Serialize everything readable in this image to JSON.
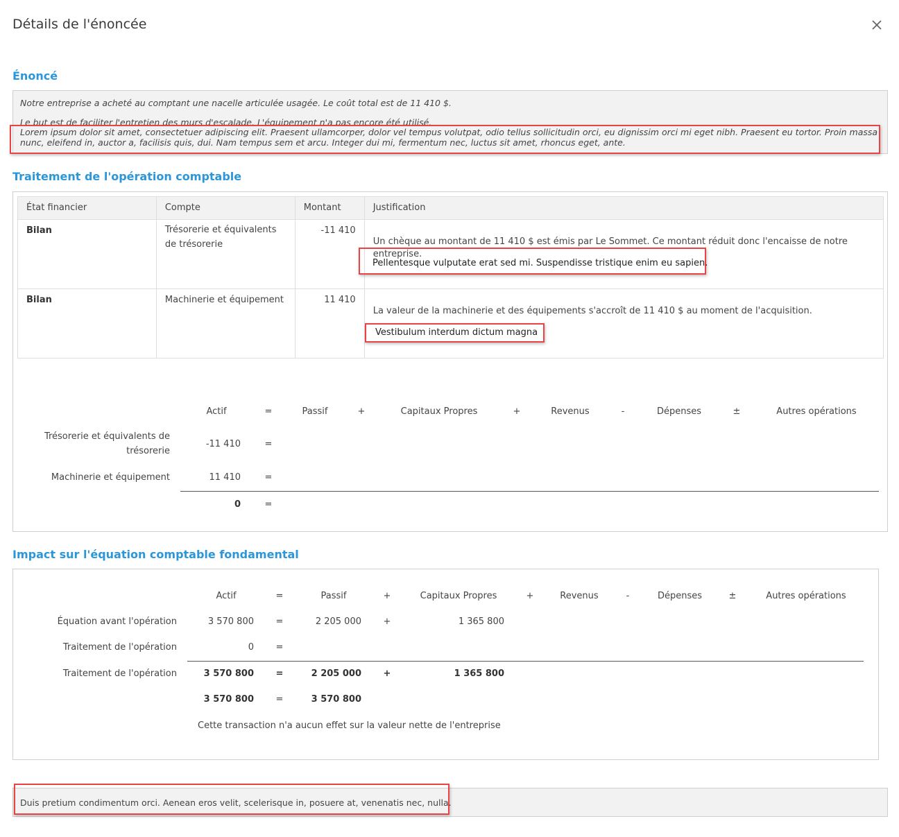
{
  "modal": {
    "title": "Détails de l'énoncée",
    "close_label": "×"
  },
  "enonce": {
    "title": "Énoncé",
    "line1": "Notre entreprise a acheté au comptant une nacelle articulée usagée. Le coût total est de 11 410 $.",
    "line2": "Le but est de faciliter l'entretien des murs d'escalade. L'équipement n'a pas encore été utilisé.",
    "lorem": "Lorem ipsum dolor sit amet, consectetuer adipiscing elit. Praesent ullamcorper, dolor vel tempus volutpat, odio tellus sollicitudin orci, eu dignissim orci mi eget nibh. Praesent eu tortor. Proin massa nunc, eleifend in, auctor a, facilisis quis, dui. Nam tempus sem et arcu. Integer dui mi, fermentum nec, luctus sit amet, rhoncus eget, ante."
  },
  "traitement": {
    "title": "Traitement de l'opération comptable",
    "headers": [
      "État financier",
      "Compte",
      "Montant",
      "Justification"
    ],
    "rows": [
      {
        "etat": "Bilan",
        "compte": "Trésorerie et équivalents de trésorerie",
        "montant": "-11 410",
        "justification": "Un chèque au montant de 11 410 $ est émis par Le Sommet. Ce montant réduit donc l'encaisse de notre entreprise.",
        "note": "Pellentesque vulputate erat sed mi. Suspendisse tristique enim eu sapien."
      },
      {
        "etat": "Bilan",
        "compte": "Machinerie et équipement",
        "montant": "11 410",
        "justification": "La valeur de la machinerie et des équipements s'accroît de 11 410 $ au moment de l'acquisition.",
        "note": "Vestibulum interdum dictum magna"
      }
    ],
    "equation": {
      "headers": {
        "actif": "Actif",
        "eq": "=",
        "passif": "Passif",
        "plus1": "+",
        "capitaux": "Capitaux Propres",
        "plus2": "+",
        "revenus": "Revenus",
        "minus": "-",
        "depenses": "Dépenses",
        "pm": "±",
        "autres": "Autres opérations"
      },
      "rows": [
        {
          "label_line1": "Trésorerie et équivalents de",
          "label_line2": "trésorerie",
          "actif": "-11 410",
          "eq": "="
        },
        {
          "label": "Machinerie et équipement",
          "actif": "11 410",
          "eq": "="
        }
      ],
      "total": {
        "actif": "0",
        "eq": "="
      }
    }
  },
  "impact": {
    "title": "Impact sur l'équation comptable fondamental",
    "headers": {
      "actif": "Actif",
      "eq": "=",
      "passif": "Passif",
      "plus1": "+",
      "capitaux": "Capitaux Propres",
      "plus2": "+",
      "revenus": "Revenus",
      "minus": "-",
      "depenses": "Dépenses",
      "pm": "±",
      "autres": "Autres opérations"
    },
    "rows": [
      {
        "label": "Équation avant l'opération",
        "actif": "3 570 800",
        "eq": "=",
        "passif": "2 205 000",
        "plus": "+",
        "capitaux": "1 365 800"
      },
      {
        "label": "Traitement de l'opération",
        "actif": "0",
        "eq": "="
      },
      {
        "label": "Traitement de l'opération",
        "actif": "3 570 800",
        "eq": "=",
        "passif": "2 205 000",
        "plus": "+",
        "capitaux": "1 365 800"
      }
    ],
    "summary": {
      "actif": "3 570 800",
      "eq": "=",
      "total": "3 570 800"
    },
    "note": "Cette transaction n'a aucun effet sur la valeur nette de l'entreprise"
  },
  "footer": {
    "text": "Duis pretium condimentum orci. Aenean eros velit, scelerisque in, posuere at, venenatis nec, nulla."
  },
  "colors": {
    "accent": "#2b96d9",
    "highlight_border": "#e94346",
    "panel_border": "#cfcfcf",
    "gray_bg": "#f2f2f2"
  }
}
